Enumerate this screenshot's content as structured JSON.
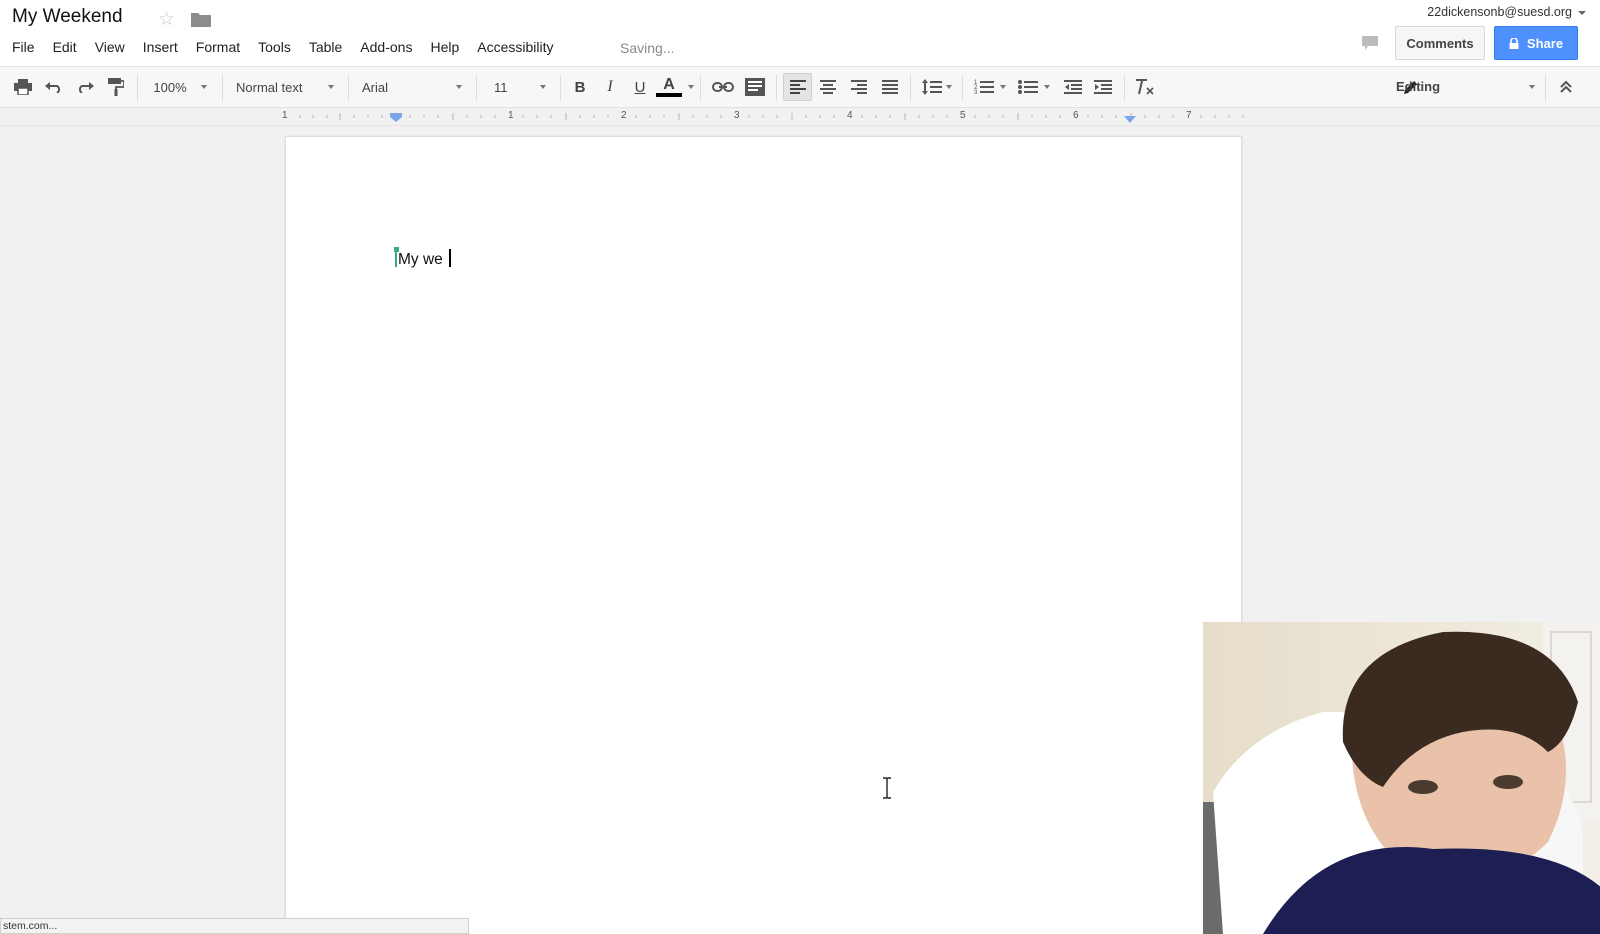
{
  "header": {
    "doc_title": "My Weekend",
    "account_email": "22dickensonb@suesd.org",
    "save_status": "Saving...",
    "comments_label": "Comments",
    "share_label": "Share"
  },
  "menu": [
    "File",
    "Edit",
    "View",
    "Insert",
    "Format",
    "Tools",
    "Table",
    "Add-ons",
    "Help",
    "Accessibility"
  ],
  "toolbar": {
    "zoom": "100%",
    "style": "Normal text",
    "font": "Arial",
    "font_size": "11",
    "bold": "B",
    "italic": "I",
    "underline": "U",
    "text_color_letter": "A",
    "mode": "Editing"
  },
  "ruler": {
    "labels": [
      "1",
      "1",
      "2",
      "3",
      "4",
      "5",
      "6",
      "7"
    ]
  },
  "document": {
    "body_text": "My we "
  },
  "status_bar": {
    "text": "stem.com..."
  },
  "colors": {
    "share_blue": "#4d90fe",
    "collaborator_marker": "#3aaa8a",
    "ruler_indent_blue": "#7aa7e8"
  },
  "icons": [
    "star-icon",
    "folder-icon",
    "chat-icon",
    "lock-icon",
    "print-icon",
    "undo-icon",
    "redo-icon",
    "paint-format-icon",
    "link-icon",
    "comment-icon",
    "align-left-icon",
    "align-center-icon",
    "align-right-icon",
    "justify-icon",
    "line-spacing-icon",
    "numbered-list-icon",
    "bulleted-list-icon",
    "decrease-indent-icon",
    "increase-indent-icon",
    "clear-formatting-icon",
    "pencil-icon",
    "collapse-icon",
    "ibeam-cursor-icon"
  ]
}
